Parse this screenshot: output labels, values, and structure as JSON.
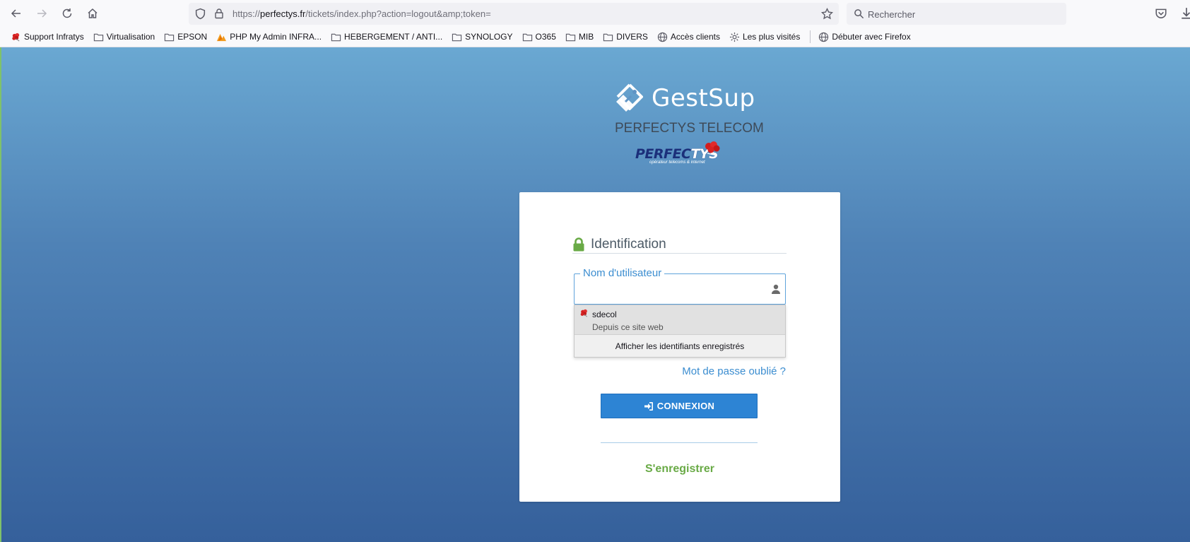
{
  "browser": {
    "url": {
      "scheme": "https://",
      "domain": "perfectys.fr",
      "path": "/tickets/index.php?action=logout&amp;token="
    },
    "search_placeholder": "Rechercher"
  },
  "bookmarks": [
    {
      "label": "Support Infratys",
      "icon": "perfectys-flower-icon"
    },
    {
      "label": "Virtualisation",
      "icon": "folder-icon"
    },
    {
      "label": "EPSON",
      "icon": "folder-icon"
    },
    {
      "label": "PHP My Admin INFRA...",
      "icon": "phpmyadmin-icon"
    },
    {
      "label": "HEBERGEMENT / ANTI...",
      "icon": "folder-icon"
    },
    {
      "label": "SYNOLOGY",
      "icon": "folder-icon"
    },
    {
      "label": "O365",
      "icon": "folder-icon"
    },
    {
      "label": "MIB",
      "icon": "folder-icon"
    },
    {
      "label": "DIVERS",
      "icon": "folder-icon"
    },
    {
      "label": "Accès clients",
      "icon": "globe-icon"
    },
    {
      "label": "Les plus visités",
      "icon": "gear-icon"
    },
    {
      "label": "Débuter avec Firefox",
      "icon": "globe-icon"
    }
  ],
  "page": {
    "app_name": "GestSup",
    "company": "PERFECTYS TELECOM",
    "company_logo": {
      "part1": "PERFEC",
      "part2": "TYS",
      "tagline": "opérateur telecoms & internet"
    },
    "login": {
      "title": "Identification",
      "username_legend": "Nom d'utilisateur",
      "username_value": "",
      "autocomplete": {
        "user": "sdecol",
        "source": "Depuis ce site web",
        "manage": "Afficher les identifiants enregistrés"
      },
      "forgot": "Mot de passe oublié ?",
      "connect": "CONNEXION",
      "register": "S'enregistrer"
    }
  },
  "colors": {
    "accent_blue": "#2d84d4",
    "green": "#69aa46",
    "bg_top": "#6aa8d2",
    "bg_bottom": "#35609b"
  }
}
